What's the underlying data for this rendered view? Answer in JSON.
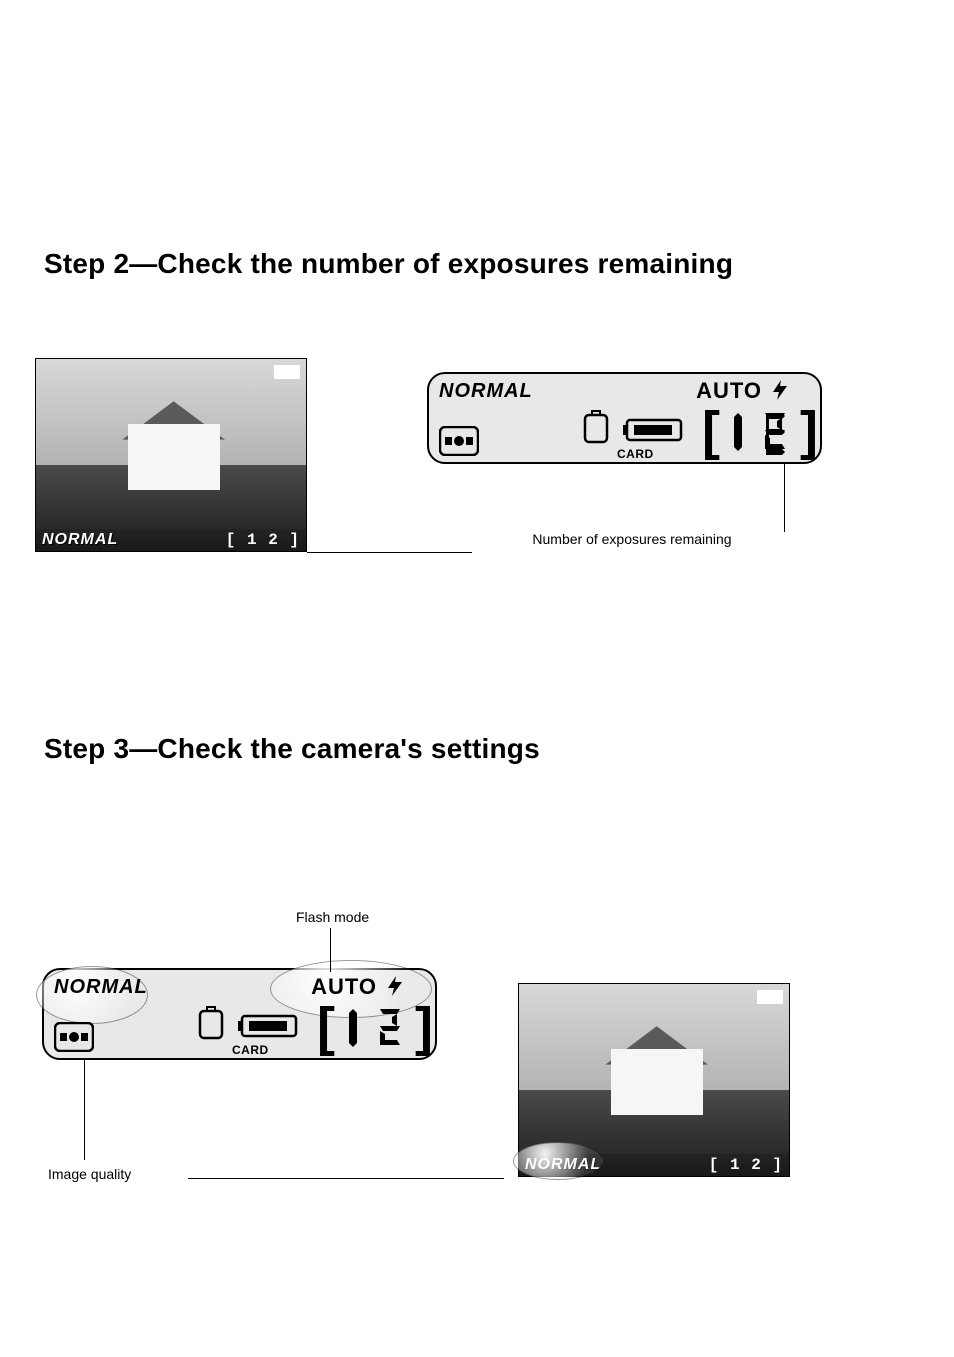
{
  "step2": {
    "heading": "Step 2—Check the number of exposures remaining",
    "monitor": {
      "quality_label": "NORMAL",
      "exposures_label": "[    1 2  ]"
    },
    "control_panel": {
      "quality": "NORMAL",
      "flash_mode": "AUTO",
      "card_label": "CARD",
      "exposures_digits": "12",
      "open_bracket": "[",
      "close_bracket": "]"
    },
    "callout_exposures": "Number of exposures remaining"
  },
  "step3": {
    "heading": "Step 3—Check the camera's settings",
    "control_panel": {
      "quality": "NORMAL",
      "flash_mode": "AUTO",
      "card_label": "CARD",
      "exposures_digits": "12",
      "open_bracket": "[",
      "close_bracket": "]"
    },
    "callout_flash": "Flash mode",
    "callout_quality": "Image quality",
    "monitor": {
      "quality_label": "NORMAL",
      "exposures_label": "[    1 2  ]"
    }
  }
}
